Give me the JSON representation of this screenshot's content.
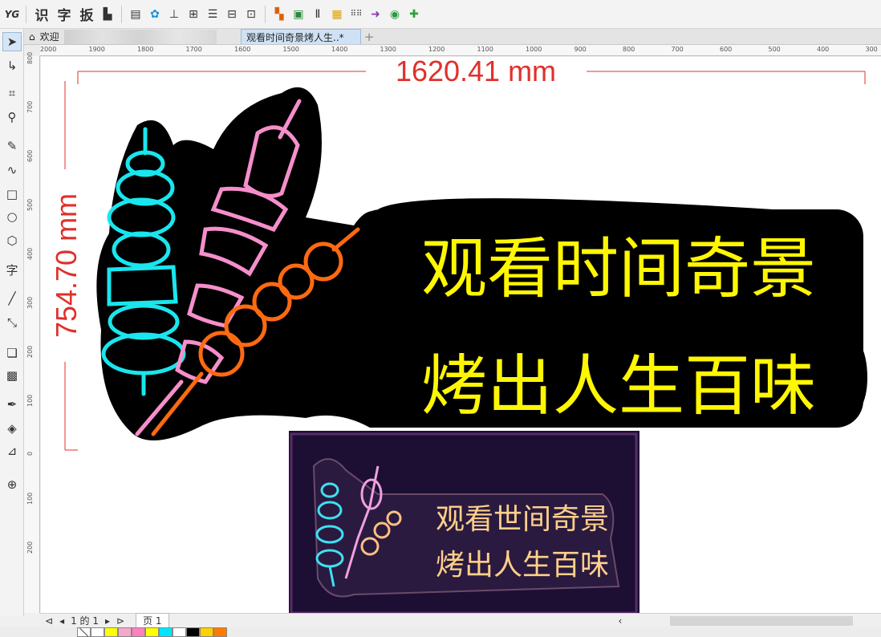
{
  "toolbar": {
    "text_tools": [
      "识",
      "字",
      "扳"
    ],
    "icons": [
      "yg-logo-icon",
      "clipboard-icon",
      "doc-icon",
      "cloud-icon",
      "anchor-icon",
      "align-icon",
      "equal-icon",
      "distribute-icon",
      "frame-icon",
      "group-color-icon",
      "shape-icon",
      "text-align-icon",
      "grid-color-icon",
      "dots-icon",
      "arrow-icon",
      "globe-icon",
      "plugin-icon"
    ]
  },
  "tabs": {
    "home_label": "欢迎",
    "document_label": "观看时间奇景烤人生..*"
  },
  "ruler": {
    "h_labels": [
      "2000",
      "1900",
      "1800",
      "1700",
      "1600",
      "1500",
      "1400",
      "1300",
      "1200",
      "1100",
      "1000",
      "900",
      "800",
      "700",
      "600",
      "500",
      "400",
      "300"
    ],
    "v_labels": [
      "800",
      "700",
      "600",
      "500",
      "400",
      "300",
      "200",
      "100",
      "0",
      "100",
      "200"
    ]
  },
  "design": {
    "width_dim": "1620.41 mm",
    "height_dim": "754.70 mm",
    "line1": "观看时间奇景",
    "line2": "烤出人生百味",
    "photo_line1": "观看世间奇景",
    "photo_line2": "烤出人生百味",
    "colors": {
      "cyan": "#19e6ee",
      "pink": "#f58fcb",
      "orange": "#ff6a10",
      "yellow": "#fff700",
      "dim_red": "#e0302a"
    }
  },
  "pagebar": {
    "page_count": "1 的 1",
    "page_tab": "页 1"
  },
  "palette": [
    "#ffffff",
    "#ffff00",
    "#f7a8c8",
    "#ff7fbf",
    "#ffff00",
    "#00e5ff",
    "#ffffff",
    "#000000",
    "#ffd000",
    "#ff7a00"
  ]
}
